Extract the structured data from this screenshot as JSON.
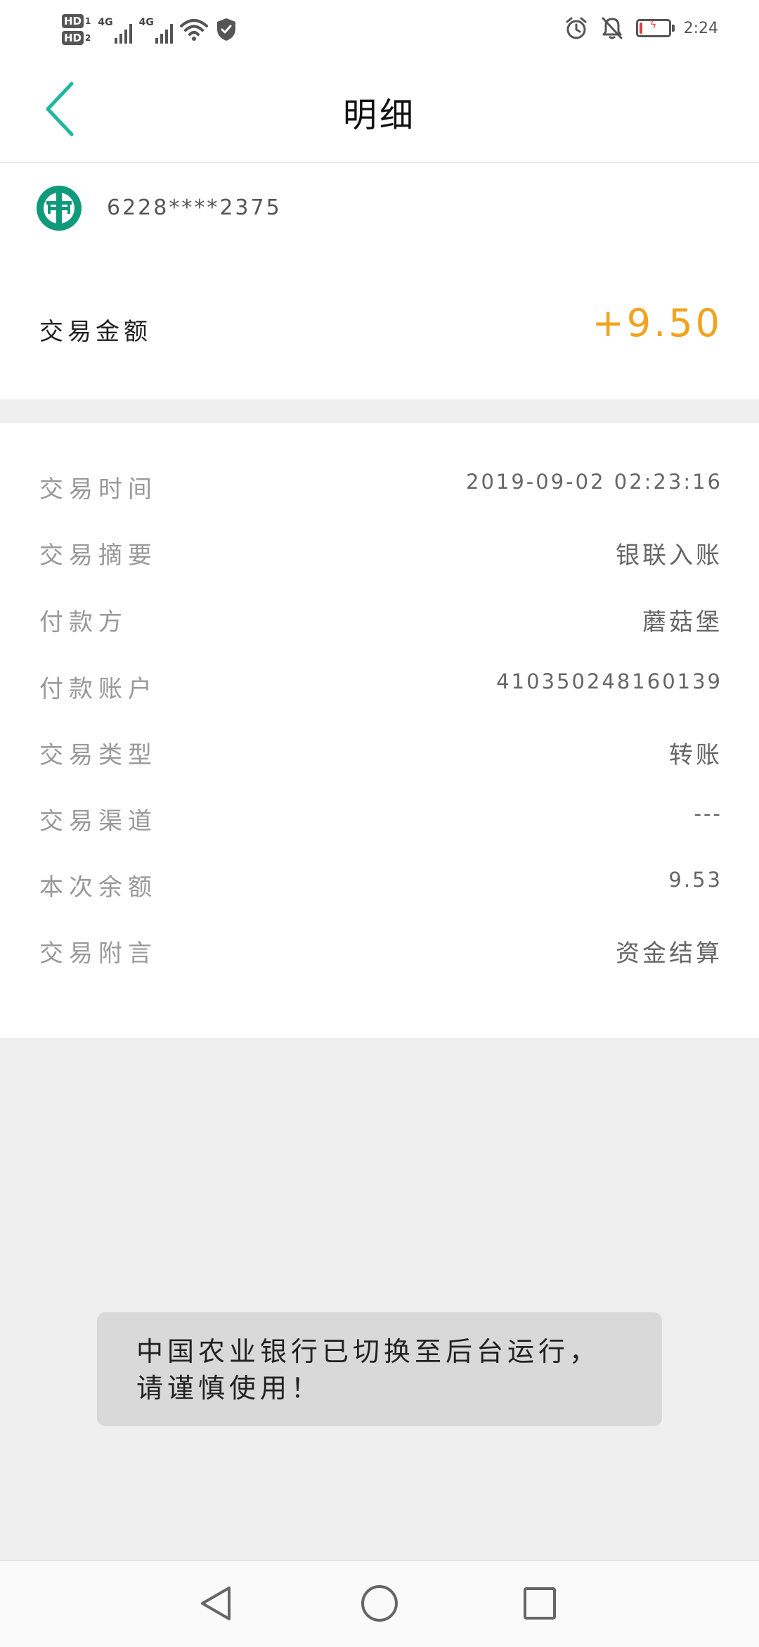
{
  "status_bar": {
    "hd1": "HD",
    "hd1_sub": "1",
    "hd2": "HD",
    "hd2_sub": "2",
    "network1": "4G",
    "network2": "4G",
    "time": "2:24",
    "battery_level": 0.1,
    "icons": [
      "signal-icon",
      "wifi-icon",
      "shield-icon",
      "alarm-icon",
      "bell-off-icon",
      "battery-icon"
    ],
    "battery_color": "#e33b3b"
  },
  "header": {
    "title": "明细",
    "back_icon": "chevron-left-icon",
    "accent_color": "#1fb79e"
  },
  "account": {
    "logo_icon": "abc-bank-logo-icon",
    "card_number": "6228****2375",
    "amount_label": "交易金额",
    "amount_value": "+9.50",
    "amount_color": "#f2a21e"
  },
  "details": [
    {
      "label": "交易时间",
      "value": "2019-09-02 02:23:16"
    },
    {
      "label": "交易摘要",
      "value": "银联入账"
    },
    {
      "label": "付款方",
      "value": "蘑菇堡"
    },
    {
      "label": "付款账户",
      "value": "410350248160139"
    },
    {
      "label": "交易类型",
      "value": "转账"
    },
    {
      "label": "交易渠道",
      "value": "---"
    },
    {
      "label": "本次余额",
      "value": "9.53"
    },
    {
      "label": "交易附言",
      "value": "资金结算"
    }
  ],
  "toast": {
    "message": "中国农业银行已切换至后台运行，请谨慎使用！"
  },
  "nav": {
    "icons": [
      "back-triangle-icon",
      "home-circle-icon",
      "recents-square-icon"
    ]
  }
}
